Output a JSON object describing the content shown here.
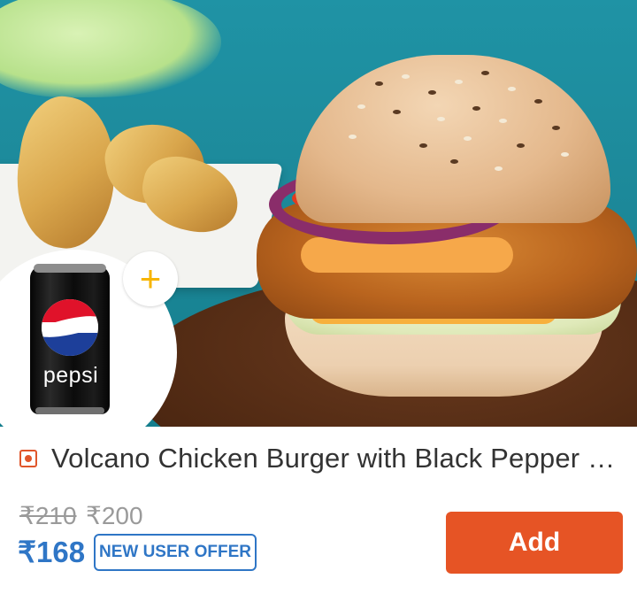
{
  "product": {
    "title": "Volcano Chicken Burger with Black Pepper Mayo + Pepsi",
    "original_price": "₹210",
    "base_price": "₹200",
    "offer_price": "₹168",
    "offer_badge": "NEW USER OFFER",
    "veg_indicator": "non-veg-icon"
  },
  "combo": {
    "drink_label": "pepsi",
    "plus_symbol": "+"
  },
  "actions": {
    "add_label": "Add"
  },
  "colors": {
    "accent": "#e65425",
    "offer_blue": "#2f76c6",
    "plus_yellow": "#f7b500"
  }
}
